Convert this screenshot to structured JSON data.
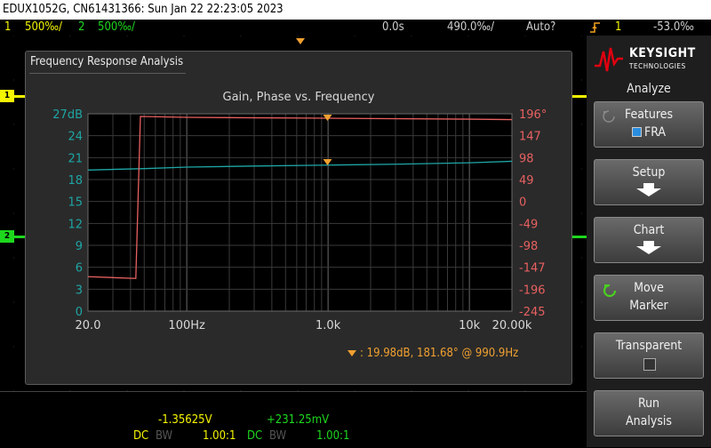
{
  "title_bar": "EDUX1052G, CN61431366: Sun Jan 22 22:23:05 2023",
  "top_status": {
    "ch1_num": "1",
    "ch1_scale": "500‰/",
    "ch2_num": "2",
    "ch2_scale": "500‰/",
    "time_delay": "0.0s",
    "time_scale": "490.0‰/",
    "trigger_mode": "Auto?",
    "trigger_icon": "trigger-edge-icon",
    "trigger_source": "1",
    "trigger_level": "-53.0‰"
  },
  "fra": {
    "window_title": "Frequency Response Analysis",
    "chart_title": "Gain, Phase vs. Frequency",
    "marker_text": ":  19.98dB, 181.68° @ 990.9Hz"
  },
  "chart_data": {
    "type": "line",
    "title": "Gain, Phase vs. Frequency",
    "xscale": "log",
    "xlim": [
      20,
      20000
    ],
    "x_tick_labels": [
      "20.0",
      "100Hz",
      "1.0k",
      "10k",
      "20.00k"
    ],
    "x_tick_values": [
      20,
      100,
      1000,
      10000,
      20000
    ],
    "y_left_ticks": [
      "27dB",
      "24",
      "21",
      "18",
      "15",
      "12",
      "9",
      "6",
      "3",
      "0"
    ],
    "y_left_lim": [
      0,
      27
    ],
    "y_right_ticks": [
      "196°",
      "147",
      "98",
      "49",
      "0",
      "-49",
      "-98",
      "-147",
      "-196",
      "-245"
    ],
    "y_right_lim": [
      -245,
      196
    ],
    "grid": true,
    "series": [
      {
        "axis": "left",
        "color": "#1fa5a5",
        "x": [
          20,
          50,
          100,
          300,
          1000,
          3000,
          10000,
          20000
        ],
        "y": [
          19.3,
          19.5,
          19.7,
          19.85,
          19.98,
          20.1,
          20.3,
          20.5
        ]
      },
      {
        "axis": "right",
        "color": "#e86060",
        "x": [
          20,
          43.5,
          43.6,
          47,
          47.1,
          100,
          1000,
          10000,
          20000
        ],
        "y": [
          -168,
          -172,
          -172,
          190,
          190,
          188,
          186,
          184,
          183
        ]
      }
    ],
    "marker_x": 990.9,
    "colors": {
      "gain": "#1fa5a5",
      "phase": "#e86060",
      "marker": "#f0a030"
    }
  },
  "bottom": {
    "ch1_value": "-1.35625V",
    "ch2_value": "+231.25mV",
    "ch1_coupling": "DC",
    "ch1_bw": "BW",
    "ch1_probe": "1.00:1",
    "ch2_coupling": "DC",
    "ch2_bw": "BW",
    "ch2_probe": "1.00:1"
  },
  "right_panel": {
    "brand": "KEYSIGHT",
    "brand_sub": "TECHNOLOGIES",
    "menu_title": "Analyze",
    "buttons": [
      {
        "l1": "Features",
        "l2": "FRA"
      },
      {
        "l1": "Setup"
      },
      {
        "l1": "Chart"
      },
      {
        "l1": "Move",
        "l2": "Marker"
      },
      {
        "l1": "Transparent"
      },
      {
        "l1": "Run",
        "l2": "Analysis"
      }
    ]
  },
  "colors": {
    "ch1": "#f5f500",
    "ch2": "#1ed81e",
    "marker": "#f0a030"
  }
}
